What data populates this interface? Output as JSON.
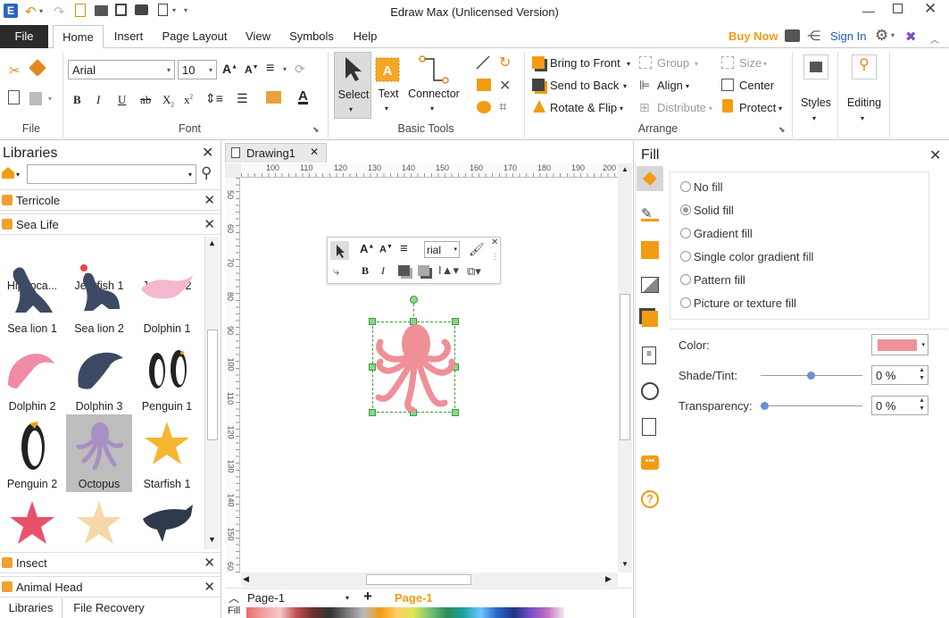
{
  "app": {
    "title": "Edraw Max (Unlicensed Version)"
  },
  "ribbon_tabs": [
    "File",
    "Home",
    "Insert",
    "Page Layout",
    "View",
    "Symbols",
    "Help"
  ],
  "right_header": {
    "buy_now": "Buy Now",
    "sign_in": "Sign In"
  },
  "font_group": {
    "label": "File",
    "font_label": "Font",
    "font_name": "Arial",
    "font_size": "10"
  },
  "basic_tools": {
    "label": "Basic Tools",
    "select": "Select",
    "text": "Text",
    "connector": "Connector"
  },
  "arrange": {
    "label": "Arrange",
    "bring_front": "Bring to Front",
    "send_back": "Send to Back",
    "rotate_flip": "Rotate & Flip",
    "group": "Group",
    "align": "Align",
    "distribute": "Distribute",
    "size": "Size",
    "center": "Center",
    "protect": "Protect"
  },
  "styles_label": "Styles",
  "editing_label": "Editing",
  "libraries": {
    "title": "Libraries",
    "search_value": "",
    "groups": [
      "Terricole",
      "Sea Life",
      "Insect",
      "Animal Head"
    ],
    "shapes": [
      "Hippoca...",
      "Jellyfish 1",
      "Jellyfish 2",
      "Sea lion 1",
      "Sea lion 2",
      "Dolphin 1",
      "Dolphin 2",
      "Dolphin 3",
      "Penguin 1",
      "Penguin 2",
      "Octopus",
      "Starfish 1"
    ],
    "bottom_tabs": [
      "Libraries",
      "File Recovery"
    ]
  },
  "document": {
    "tab_name": "Drawing1",
    "ruler_h": [
      "100",
      "110",
      "120",
      "130",
      "140",
      "150",
      "160",
      "170",
      "180",
      "190",
      "200"
    ],
    "ruler_v": [
      "50",
      "60",
      "70",
      "80",
      "90",
      "100",
      "110",
      "120",
      "130",
      "140",
      "150",
      "60"
    ],
    "page_select": "Page-1",
    "page_tab": "Page-1",
    "fill_label": "Fill",
    "mini_font": "rial"
  },
  "fill_pane": {
    "title": "Fill",
    "options": [
      "No fill",
      "Solid fill",
      "Gradient fill",
      "Single color gradient fill",
      "Pattern fill",
      "Picture or texture fill"
    ],
    "selected": "Solid fill",
    "color_label": "Color:",
    "color_value": "#f0909a",
    "shade_label": "Shade/Tint:",
    "shade_value": "0 %",
    "transparency_label": "Transparency:",
    "transparency_value": "0 %"
  },
  "colors": {
    "accent_orange": "#f39c12",
    "octopus": "#ef8f98",
    "octopus_lib": "#a98fc2",
    "link_blue": "#1e5fb3"
  }
}
